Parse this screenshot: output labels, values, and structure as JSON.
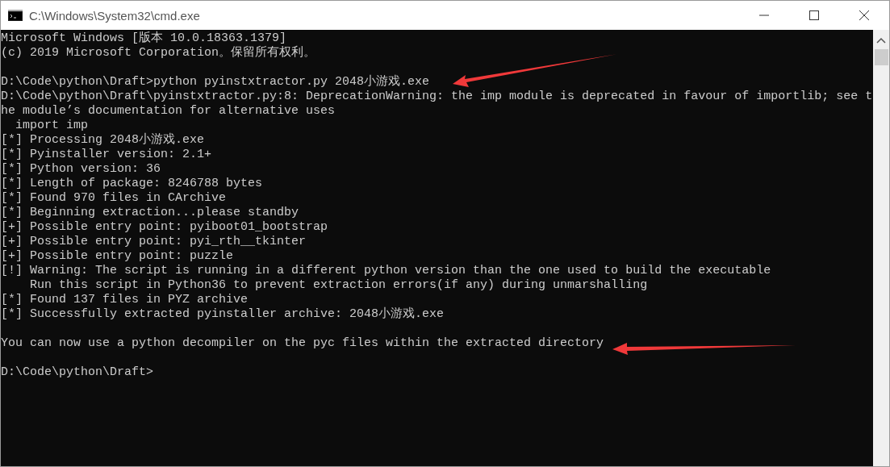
{
  "window": {
    "title": "C:\\Windows\\System32\\cmd.exe"
  },
  "console": {
    "blocks": [
      [
        "Microsoft Windows [版本 10.0.18363.1379]",
        "(c) 2019 Microsoft Corporation。保留所有权利。"
      ],
      [
        "D:\\Code\\python\\Draft>python pyinstxtractor.py 2048小游戏.exe",
        "D:\\Code\\python\\Draft\\pyinstxtractor.py:8: DeprecationWarning: the imp module is deprecated in favour of importlib; see t",
        "he module’s documentation for alternative uses",
        "  import imp",
        "[*] Processing 2048小游戏.exe",
        "[*] Pyinstaller version: 2.1+",
        "[*] Python version: 36",
        "[*] Length of package: 8246788 bytes",
        "[*] Found 970 files in CArchive",
        "[*] Beginning extraction...please standby",
        "[+] Possible entry point: pyiboot01_bootstrap",
        "[+] Possible entry point: pyi_rth__tkinter",
        "[+] Possible entry point: puzzle",
        "[!] Warning: The script is running in a different python version than the one used to build the executable",
        "    Run this script in Python36 to prevent extraction errors(if any) during unmarshalling",
        "[*] Found 137 files in PYZ archive",
        "[*] Successfully extracted pyinstaller archive: 2048小游戏.exe"
      ],
      [
        "You can now use a python decompiler on the pyc files within the extracted directory"
      ],
      [
        "D:\\Code\\python\\Draft>"
      ]
    ]
  }
}
